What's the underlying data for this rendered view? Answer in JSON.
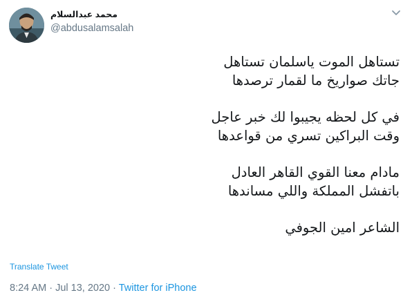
{
  "user": {
    "display_name": "محمد عبدالسلام",
    "handle": "@abdusalamsalah"
  },
  "icons": {
    "menu": "chevron-down-icon"
  },
  "tweet": {
    "lines": [
      "تستاهل الموت ياسلمان تستاهل",
      "جاتك صواريخ ما لقمار ترصدها",
      "",
      "في كل لحظه يجيبوا لك خبر عاجل",
      "وقت البراكين تسري من قواعدها",
      "",
      "مادام معنا القوي القاهر العادل",
      "باتفشل المملكة واللي مساندها",
      "",
      "الشاعر امين الجوفي"
    ],
    "translate_label": "Translate Tweet"
  },
  "meta": {
    "time": "8:24 AM",
    "separator1": " · ",
    "date": "Jul 13, 2020",
    "separator2": " · ",
    "source": "Twitter for iPhone"
  },
  "colors": {
    "link": "#1b95e0",
    "secondary": "#657786",
    "text": "#14171a"
  }
}
